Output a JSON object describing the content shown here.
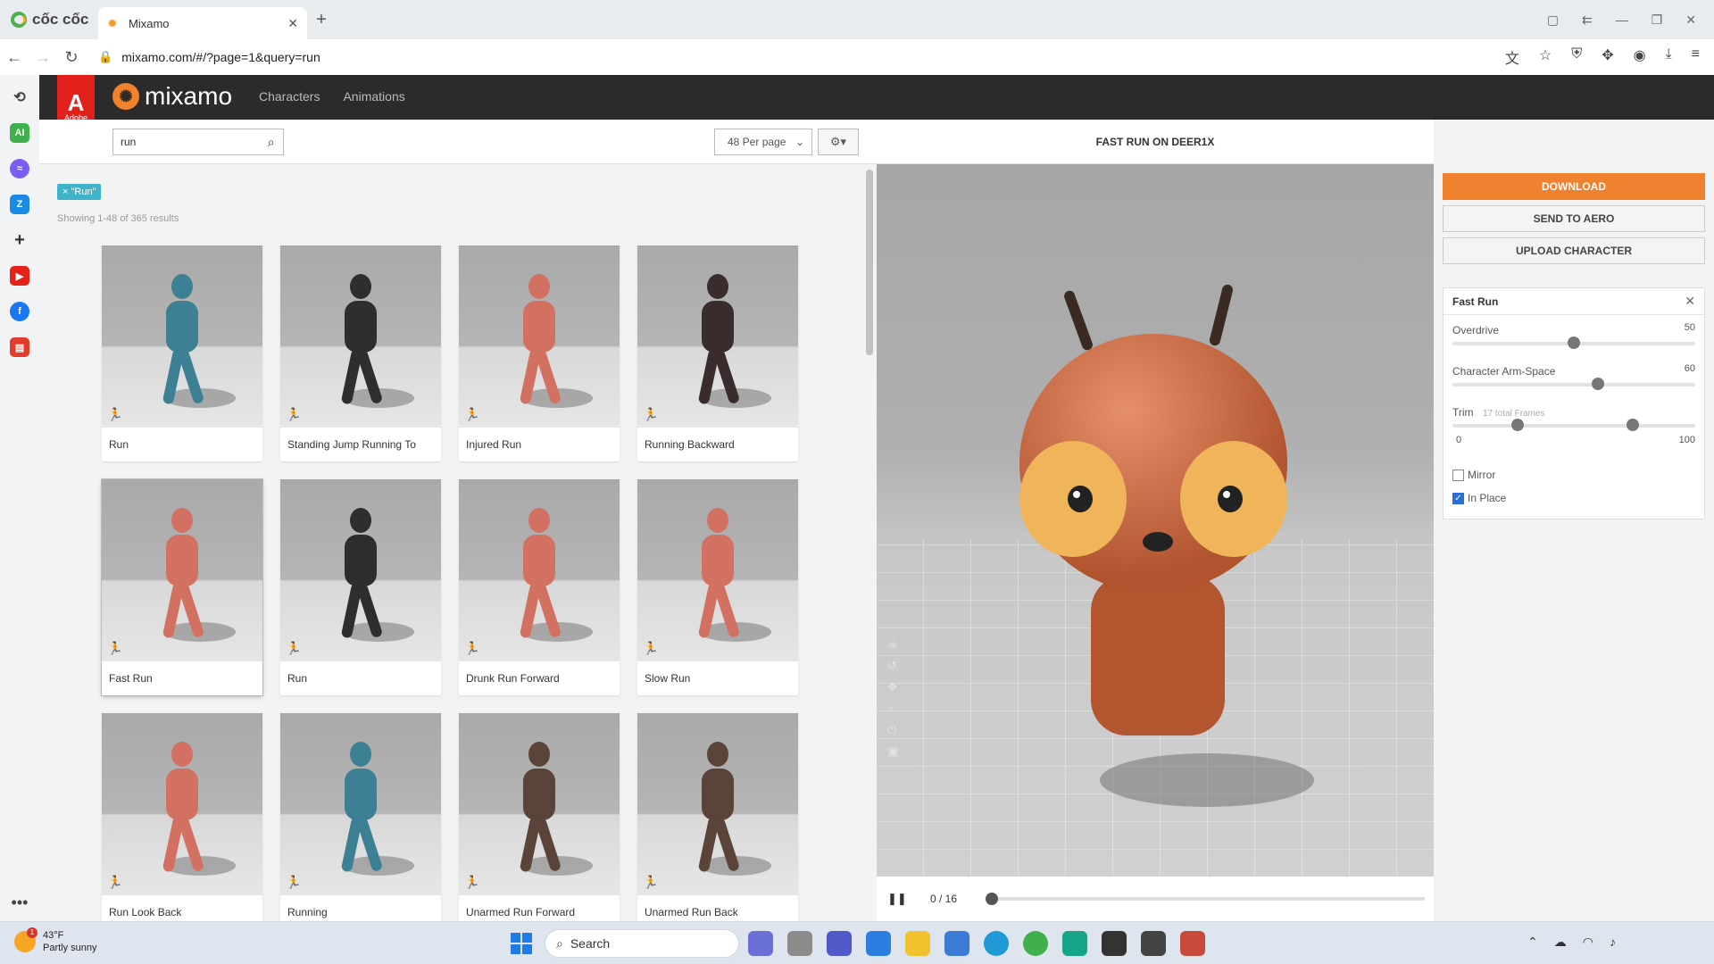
{
  "browser": {
    "brand": "cốc cốc",
    "tab_title": "Mixamo",
    "new_tab_label": "+",
    "url": "mixamo.com/#/?page=1&query=run"
  },
  "mixamo": {
    "adobe_label": "Adobe",
    "logo_text": "mixamo",
    "nav": [
      "Characters",
      "Animations"
    ]
  },
  "left": {
    "search_value": "run",
    "per_page": "48 Per page",
    "filter_tag": "× \"Run\"",
    "results_text": "Showing 1-48 of 365 results",
    "cards": [
      {
        "label": "Run",
        "color": "#3d7f93"
      },
      {
        "label": "Standing Jump Running To",
        "color": "#2e2e2e"
      },
      {
        "label": "Injured Run",
        "color": "#d27062"
      },
      {
        "label": "Running Backward",
        "color": "#3a2c2c"
      },
      {
        "label": "Fast Run",
        "color": "#d27062"
      },
      {
        "label": "Run",
        "color": "#2e2e2e"
      },
      {
        "label": "Drunk Run Forward",
        "color": "#d27062"
      },
      {
        "label": "Slow Run",
        "color": "#d27062"
      },
      {
        "label": "Run Look Back",
        "color": "#d27062"
      },
      {
        "label": "Running",
        "color": "#3d7f93"
      },
      {
        "label": "Unarmed Run Forward",
        "color": "#5a4338"
      },
      {
        "label": "Unarmed Run Back",
        "color": "#5a4338"
      }
    ],
    "selected_index": 4
  },
  "viewer": {
    "title": "FAST RUN ON DEER1X",
    "frame_text": "0 / 16",
    "frame_position": 0
  },
  "right": {
    "download": "DOWNLOAD",
    "send_to_aero": "SEND TO AERO",
    "upload_character": "UPLOAD CHARACTER",
    "settings": {
      "title": "Fast Run",
      "overdrive_label": "Overdrive",
      "overdrive_value": "50",
      "arm_space_label": "Character Arm-Space",
      "arm_space_value": "60",
      "trim_label": "Trim",
      "trim_sub": "17 total Frames",
      "trim_min": "0",
      "trim_max": "100",
      "trim_start": 25,
      "trim_end": 74,
      "mirror_label": "Mirror",
      "mirror_checked": false,
      "in_place_label": "In Place",
      "in_place_checked": true
    }
  },
  "taskbar": {
    "temp": "43°F",
    "condition": "Partly sunny",
    "badge": "1",
    "search_placeholder": "Search"
  },
  "colors": {
    "accent": "#f0812e",
    "header_bg": "#2b2b2b",
    "adobe_red": "#e2211c",
    "tag": "#3fb3c9"
  }
}
